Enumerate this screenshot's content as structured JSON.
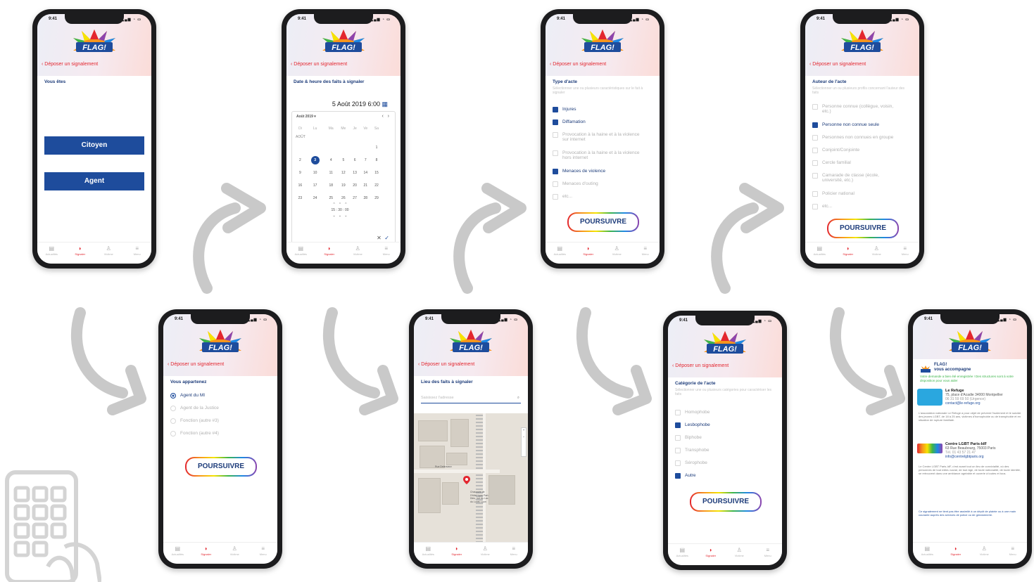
{
  "app": {
    "status_time": "9:41",
    "logo_text": "FLAG!",
    "back_label": "Déposer un signalement",
    "tabs": [
      "Actualités",
      "Signaler",
      "Victime",
      "Menu"
    ],
    "continue_label": "POURSUIVRE"
  },
  "colors": {
    "brand_blue": "#1e4c9c",
    "brand_red": "#e3262f",
    "title_navy": "#1d3c7a"
  },
  "icons": {
    "tab_news": "newspaper-icon",
    "tab_report": "megaphone-icon",
    "tab_victim": "person-icon",
    "tab_menu": "hamburger-icon",
    "corner": "smartphone-keypad-icon",
    "flow": "curved-arrow-icon"
  },
  "screens": {
    "s1": {
      "title": "Vous êtes",
      "buttons": [
        "Citoyen",
        "Agent"
      ]
    },
    "s2": {
      "title": "Date & heure des faits à signaler",
      "datetime": "5 Août 2019    6:00",
      "month_label": "Août 2019",
      "month_header": "AOÛT",
      "weekdays": [
        "Di",
        "Lu",
        "Ma",
        "Me",
        "Je",
        "Ve",
        "Sa"
      ],
      "weeks": [
        [
          "",
          "",
          "",
          "",
          "",
          "",
          "1"
        ],
        [
          "2",
          "3",
          "4",
          "5",
          "6",
          "7",
          "8"
        ],
        [
          "9",
          "10",
          "11",
          "12",
          "13",
          "14",
          "15"
        ],
        [
          "16",
          "17",
          "18",
          "19",
          "20",
          "21",
          "22"
        ],
        [
          "23",
          "24",
          "25",
          "26",
          "27",
          "28",
          "29"
        ]
      ],
      "selected_day": "3",
      "time_picker": [
        "15",
        "30",
        "00"
      ]
    },
    "s3": {
      "title": "Type d'acte",
      "subtitle": "Sélectionner une ou plusieurs caractéristiques sur le fait à signaler",
      "options": [
        {
          "label": "Injures",
          "checked": true
        },
        {
          "label": "Diffamation",
          "checked": true
        },
        {
          "label": "Provocation à la haine et à la violence sur internet",
          "checked": false
        },
        {
          "label": "Provocation à la haine et à la violence hors internet",
          "checked": false
        },
        {
          "label": "Menaces de violence",
          "checked": true
        },
        {
          "label": "Menaces d'outing",
          "checked": false
        },
        {
          "label": "etc...",
          "checked": false
        }
      ]
    },
    "s4": {
      "title": "Auteur de l'acte",
      "subtitle": "Sélectionner un ou plusieurs profils concernant l'auteur des faits",
      "options": [
        {
          "label": "Personne connue (collègue, voisin, etc.)",
          "checked": false
        },
        {
          "label": "Personne non connue seule",
          "checked": true
        },
        {
          "label": "Personnes non connues en groupe",
          "checked": false
        },
        {
          "label": "Conjoint/Conjointe",
          "checked": false
        },
        {
          "label": "Cercle familial",
          "checked": false
        },
        {
          "label": "Camarade de classe (école, université, etc.)",
          "checked": false
        },
        {
          "label": "Policier national",
          "checked": false
        },
        {
          "label": "etc...",
          "checked": false
        }
      ]
    },
    "s5": {
      "title": "Vous appartenez",
      "options": [
        {
          "label": "Agent du MI",
          "checked": true
        },
        {
          "label": "Agent de la Justice",
          "checked": false
        },
        {
          "label": "Fonction (autre #3)",
          "checked": false
        },
        {
          "label": "Fonction (autre #4)",
          "checked": false
        }
      ]
    },
    "s6": {
      "title": "Lieu des faits à signaler",
      "search_placeholder": "Saisissez l'adresse",
      "map_street": "Rue Deleuvaux",
      "map_label": "Chaussée de l'Hôtel Lyon Part-Dieu, rue du Lac du Lunel, Lyon"
    },
    "s7": {
      "title": "Catégorie de l'acte",
      "subtitle": "Sélectionner une ou plusieurs catégories pour caractériser les faits",
      "options": [
        {
          "label": "Homophobe",
          "checked": false
        },
        {
          "label": "Lesbophobe",
          "checked": true
        },
        {
          "label": "Biphobe",
          "checked": false
        },
        {
          "label": "Transphobe",
          "checked": false
        },
        {
          "label": "Sérophobe",
          "checked": false
        },
        {
          "label": "Autre",
          "checked": true
        }
      ]
    },
    "s8": {
      "brand": "FLAG!",
      "heading": "vous accompagne",
      "subtitle": "Votre demande a bien été enregistrée ! Des structures sont à votre disposition pour vous aider",
      "orgs": [
        {
          "name": "Le Refuge",
          "address": "75, place d'Acadie 34000 Montpellier",
          "phone": "06 31 59 69 50 (Urgence)",
          "email": "contact@le-refuge.org",
          "desc": "L'association nationale Le Refuge a pour objet de prévenir l'isolement et le suicide des jeunes LGBT, de 18 à 25 ans, victimes d'homophobie ou de transphobie et en situation de rupture familiale."
        },
        {
          "name": "Centre LGBT Paris-IdF",
          "address": "63 Rue Beaubourg, 75003 Paris",
          "phone": "Tél. 01 43 57 21 47",
          "email": "info@centrelgbtparis.org",
          "desc": "Le Centre LGBT Paris-IdF, c'est avant tout un lieu de convivialité, où des personnes de tout milieu social, de tout âge, de toute nationalité, de toute identité, se retrouvent dans une ambiance agréable et ouverte à toutes et tous."
        }
      ],
      "footer": "Ce signalement ne tient pas être assimilé à un dépôt de plainte ou à une main courante auprès des services de police ou de gendarmerie."
    }
  }
}
